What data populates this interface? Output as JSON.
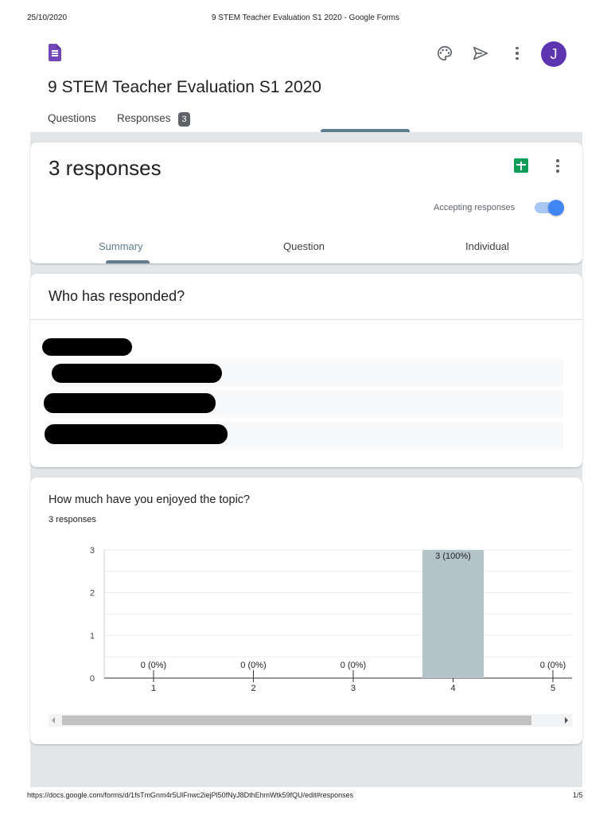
{
  "print_header": {
    "date": "25/10/2020",
    "page_title": "9 STEM Teacher Evaluation S1 2020 - Google Forms"
  },
  "print_footer": {
    "url": "https://docs.google.com/forms/d/1fsTmGnm4r5UlFnwc2iejPl50fNyJ8DthEhmWtk59fQU/edit#responses",
    "page": "1/5"
  },
  "toolbar": {
    "avatar_letter": "J",
    "icons": [
      "forms-logo-icon",
      "palette-icon",
      "send-icon",
      "more-vert-icon"
    ]
  },
  "form": {
    "title": "9 STEM Teacher Evaluation S1 2020"
  },
  "tabs": {
    "questions": "Questions",
    "responses": "Responses",
    "responses_badge": "3"
  },
  "responses_card": {
    "count_label": "3 responses",
    "accepting_label": "Accepting responses",
    "accepting": true,
    "subtabs": [
      "Summary",
      "Question",
      "Individual"
    ],
    "active_subtab": "Summary"
  },
  "respondents_card": {
    "title": "Who has responded?"
  },
  "question_card": {
    "title": "How much have you enjoyed the topic?",
    "count_label": "3 responses"
  },
  "chart_data": {
    "type": "bar",
    "categories": [
      "1",
      "2",
      "3",
      "4",
      "5"
    ],
    "values": [
      0,
      0,
      0,
      3,
      0
    ],
    "data_labels": [
      "0 (0%)",
      "0 (0%)",
      "0 (0%)",
      "3 (100%)",
      "0 (0%)"
    ],
    "yticks": [
      "0",
      "1",
      "2",
      "3"
    ],
    "ylim": [
      0,
      3
    ],
    "bar_color": "#b4c3ca",
    "grid": true
  },
  "colors": {
    "accent": "#5f7d8e",
    "brand": "#7248b9",
    "avatar": "#5e35b1",
    "toggle": "#4285f4",
    "sheets": "#0f9d58"
  }
}
